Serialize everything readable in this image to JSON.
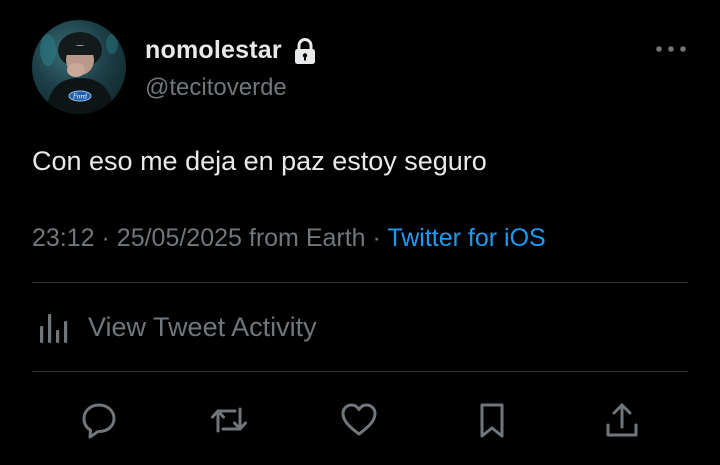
{
  "author": {
    "display_name": "nomolestar",
    "handle": "@tecitoverde",
    "protected_icon": "lock-icon",
    "avatar_shirt_text": "Ford"
  },
  "tweet": {
    "text": "Con eso me deja en paz estoy seguro",
    "time": "23:12",
    "date": "25/05/2025",
    "location": "from Earth",
    "separator": "·",
    "source": "Twitter for iOS"
  },
  "activity": {
    "label": "View Tweet Activity",
    "icon": "bar-chart-icon"
  },
  "actions": [
    {
      "name": "reply",
      "icon": "reply-icon"
    },
    {
      "name": "retweet",
      "icon": "retweet-icon"
    },
    {
      "name": "like",
      "icon": "heart-icon"
    },
    {
      "name": "bookmark",
      "icon": "bookmark-icon"
    },
    {
      "name": "share",
      "icon": "share-icon"
    }
  ],
  "colors": {
    "background": "#000000",
    "primary_text": "#e7e9ea",
    "secondary_text": "#71767b",
    "link": "#1d9bf0",
    "divider": "#2f3336"
  }
}
